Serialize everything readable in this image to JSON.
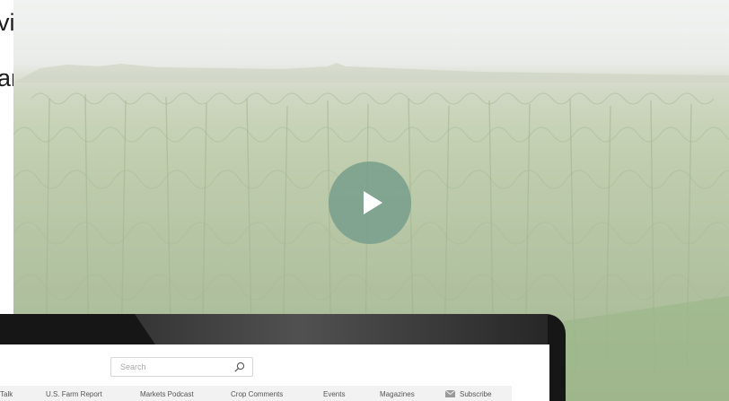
{
  "headline": {
    "line1": "vity.",
    "line2": "and"
  },
  "video": {
    "play_icon": "play-icon"
  },
  "laptop": {
    "search": {
      "placeholder": "Search",
      "icon": "search-icon"
    },
    "nav": {
      "items": [
        {
          "label": "Talk"
        },
        {
          "label": "U.S. Farm Report"
        },
        {
          "label": "Markets Podcast"
        },
        {
          "label": "Crop Comments"
        },
        {
          "label": "Events"
        },
        {
          "label": "Magazines"
        },
        {
          "label": "Subscribe",
          "icon": "mail-icon"
        }
      ]
    }
  },
  "colors": {
    "play_button": "#749c8a",
    "laptop_bezel": "#161616",
    "nav_background": "#f2f2f2",
    "headline_text": "#1b1b1b"
  }
}
